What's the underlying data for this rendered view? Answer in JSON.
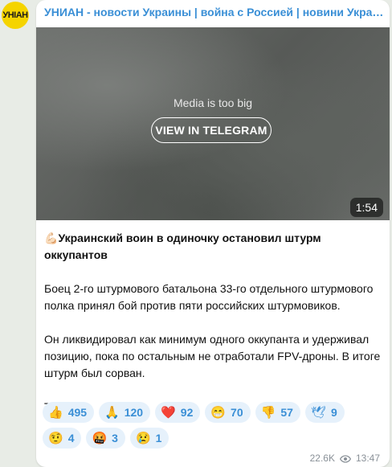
{
  "channel": {
    "avatar_text": "УНІАН",
    "title": "УНИАН - новости Украины | война с Россией | новини України | Війна з Росією"
  },
  "media": {
    "notice": "Media is too big",
    "view_button": "VIEW IN TELEGRAM",
    "duration": "1:54"
  },
  "post": {
    "headline_emoji": "💪🏻",
    "headline": "Украинский воин в одиночку остановил штурм оккупантов",
    "paragraph1": "Боец 2-го штурмового батальона 33-го отдельного штурмового полка принял бой против пяти российских штурмовиков.",
    "paragraph2": "Он ликвидировал как минимум одного оккупанта и удерживал позицию, пока по остальным не отработали FPV-дроны. В итоге штурм был сорван.",
    "paragraph3": "Титан!"
  },
  "reactions": [
    {
      "emoji": "👍",
      "count": "495"
    },
    {
      "emoji": "🙏",
      "count": "120"
    },
    {
      "emoji": "❤️",
      "count": "92"
    },
    {
      "emoji": "😁",
      "count": "70"
    },
    {
      "emoji": "👎",
      "count": "57"
    },
    {
      "emoji": "🕊",
      "count": "9"
    },
    {
      "emoji": "🤨",
      "count": "4"
    },
    {
      "emoji": "🤬",
      "count": "3"
    },
    {
      "emoji": "😢",
      "count": "1"
    }
  ],
  "meta": {
    "views": "22.6K",
    "time": "13:47"
  },
  "colors": {
    "accent": "#3a8fd6",
    "avatar_bg": "#f5d400",
    "reaction_bg": "#e6f1fb"
  }
}
